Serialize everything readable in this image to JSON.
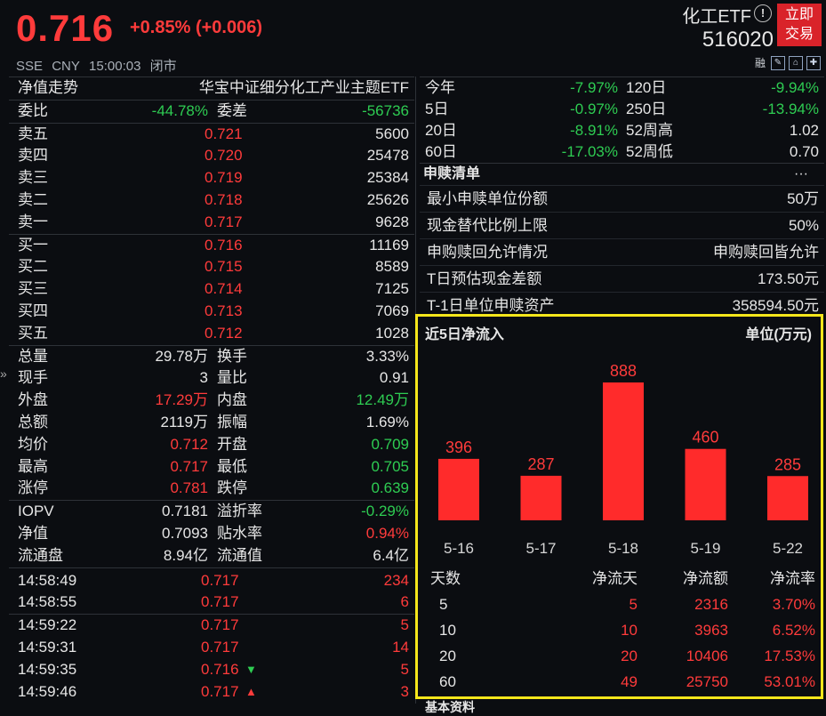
{
  "header": {
    "price": "0.716",
    "change": "+0.85% (+0.006)",
    "exchange": "SSE",
    "currency": "CNY",
    "time": "15:00:03",
    "status": "闭市",
    "name": "化工ETF",
    "code": "516020",
    "trade_btn_line1": "立即",
    "trade_btn_line2": "交易",
    "tool_margin": "融"
  },
  "left": {
    "nav_label": "净值走势",
    "fund_name": "华宝中证细分化工产业主题ETF",
    "weibi_label": "委比",
    "weibi_value": "-44.78%",
    "weicha_label": "委差",
    "weicha_value": "-56736",
    "asks": [
      {
        "label": "卖五",
        "price": "0.721",
        "vol": "5600"
      },
      {
        "label": "卖四",
        "price": "0.720",
        "vol": "25478"
      },
      {
        "label": "卖三",
        "price": "0.719",
        "vol": "25384"
      },
      {
        "label": "卖二",
        "price": "0.718",
        "vol": "25626"
      },
      {
        "label": "卖一",
        "price": "0.717",
        "vol": "9628"
      }
    ],
    "bids": [
      {
        "label": "买一",
        "price": "0.716",
        "vol": "11169"
      },
      {
        "label": "买二",
        "price": "0.715",
        "vol": "8589"
      },
      {
        "label": "买三",
        "price": "0.714",
        "vol": "7125"
      },
      {
        "label": "买四",
        "price": "0.713",
        "vol": "7069"
      },
      {
        "label": "买五",
        "price": "0.712",
        "vol": "1028"
      }
    ],
    "stats": [
      {
        "l1": "总量",
        "v1": "29.78万",
        "c1": "white",
        "l2": "换手",
        "v2": "3.33%",
        "c2": "white"
      },
      {
        "l1": "现手",
        "v1": "3",
        "c1": "white",
        "l2": "量比",
        "v2": "0.91",
        "c2": "white"
      },
      {
        "l1": "外盘",
        "v1": "17.29万",
        "c1": "red",
        "l2": "内盘",
        "v2": "12.49万",
        "c2": "green"
      },
      {
        "l1": "总额",
        "v1": "2119万",
        "c1": "white",
        "l2": "振幅",
        "v2": "1.69%",
        "c2": "white"
      },
      {
        "l1": "均价",
        "v1": "0.712",
        "c1": "red",
        "l2": "开盘",
        "v2": "0.709",
        "c2": "green"
      },
      {
        "l1": "最高",
        "v1": "0.717",
        "c1": "red",
        "l2": "最低",
        "v2": "0.705",
        "c2": "green"
      },
      {
        "l1": "涨停",
        "v1": "0.781",
        "c1": "red",
        "l2": "跌停",
        "v2": "0.639",
        "c2": "green"
      }
    ],
    "nav_stats": [
      {
        "l1": "IOPV",
        "v1": "0.7181",
        "c1": "white",
        "l2": "溢折率",
        "v2": "-0.29%",
        "c2": "green"
      },
      {
        "l1": "净值",
        "v1": "0.7093",
        "c1": "white",
        "l2": "贴水率",
        "v2": "0.94%",
        "c2": "red"
      },
      {
        "l1": "流通盘",
        "v1": "8.94亿",
        "c1": "white",
        "l2": "流通值",
        "v2": "6.4亿",
        "c2": "white"
      }
    ],
    "ticks": [
      {
        "time": "14:58:49",
        "price": "0.717",
        "arrow": "",
        "vol": "234"
      },
      {
        "time": "14:58:55",
        "price": "0.717",
        "arrow": "",
        "vol": "6"
      },
      {
        "time": "14:59:22",
        "price": "0.717",
        "arrow": "",
        "vol": "5"
      },
      {
        "time": "14:59:31",
        "price": "0.717",
        "arrow": "",
        "vol": "14"
      },
      {
        "time": "14:59:35",
        "price": "0.716",
        "arrow": "down",
        "vol": "5"
      },
      {
        "time": "14:59:46",
        "price": "0.717",
        "arrow": "up",
        "vol": "3"
      }
    ]
  },
  "right": {
    "perf": [
      {
        "l1": "今年",
        "v1": "-7.97%",
        "c1": "green",
        "l2": "120日",
        "v2": "-9.94%",
        "c2": "green"
      },
      {
        "l1": "5日",
        "v1": "-0.97%",
        "c1": "green",
        "l2": "250日",
        "v2": "-13.94%",
        "c2": "green"
      },
      {
        "l1": "20日",
        "v1": "-8.91%",
        "c1": "green",
        "l2": "52周高",
        "v2": "1.02",
        "c2": "white"
      },
      {
        "l1": "60日",
        "v1": "-17.03%",
        "c1": "green",
        "l2": "52周低",
        "v2": "0.70",
        "c2": "white"
      }
    ],
    "creation_title": "申赎清单",
    "creation_more": "···",
    "creation": [
      {
        "label": "最小申赎单位份额",
        "value": "50万"
      },
      {
        "label": "现金替代比例上限",
        "value": "50%"
      },
      {
        "label": "申购赎回允许情况",
        "value": "申购赎回皆允许"
      },
      {
        "label": "T日预估现金差额",
        "value": "173.50元"
      },
      {
        "label": "T-1日单位申赎资产",
        "value": "358594.50元"
      }
    ],
    "flow_title": "近5日净流入",
    "flow_unit": "单位(万元)",
    "flow_headers": [
      "天数",
      "净流天",
      "净流额",
      "净流率"
    ],
    "flow_rows": [
      {
        "days": "5",
        "flow_days": "5",
        "amount": "2316",
        "rate": "3.70%"
      },
      {
        "days": "10",
        "flow_days": "10",
        "amount": "3963",
        "rate": "6.52%"
      },
      {
        "days": "20",
        "flow_days": "20",
        "amount": "10406",
        "rate": "17.53%"
      },
      {
        "days": "60",
        "flow_days": "49",
        "amount": "25750",
        "rate": "53.01%"
      }
    ],
    "bottom_peek": "基本资料"
  },
  "chart_data": {
    "type": "bar",
    "categories": [
      "5-16",
      "5-17",
      "5-18",
      "5-19",
      "5-22"
    ],
    "values": [
      396,
      287,
      888,
      460,
      285
    ],
    "ylim": [
      0,
      888
    ],
    "bar_color": "#ff2b2b",
    "grid": false
  }
}
